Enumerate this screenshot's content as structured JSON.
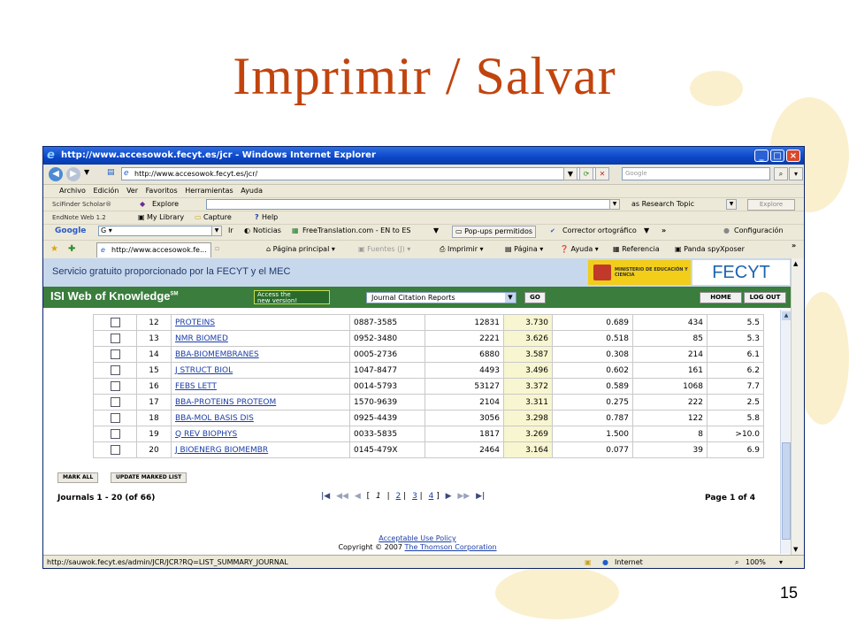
{
  "slide": {
    "title": "Imprimir / Salvar",
    "number": "15"
  },
  "window": {
    "title": "http://www.accesowok.fecyt.es/jcr - Windows Internet Explorer",
    "controls": [
      "_",
      "□",
      "×"
    ]
  },
  "address": {
    "url": "http://www.accesowok.fecyt.es/jcr/",
    "search_placeholder": "Google"
  },
  "menu": [
    "Archivo",
    "Edición",
    "Ver",
    "Favoritos",
    "Herramientas",
    "Ayuda"
  ],
  "toolbars": {
    "scifinder": {
      "label": "SciFinder Scholar®",
      "explore": "Explore",
      "topic": "as Research Topic",
      "explore_btn": "Explore"
    },
    "endnote": {
      "label": "EndNote Web 1.2",
      "my_library": "My Library",
      "capture": "Capture",
      "help": "Help"
    },
    "google": {
      "logo": "Google",
      "g_box": "G",
      "ir": "Ir",
      "noticias": "Noticias",
      "freetranslation": "FreeTranslation.com - EN to ES",
      "popups": "Pop-ups permitidos",
      "corrector": "Corrector ortográfico",
      "chevron": "»",
      "config": "Configuración"
    }
  },
  "tab": {
    "label": "http://www.accesowok.fe..."
  },
  "commands": {
    "home": "Página principal",
    "feeds": "Fuentes (J)",
    "print": "Imprimir",
    "page": "Página",
    "help": "Ayuda",
    "ref": "Referencia",
    "panda": "Panda spyXposer"
  },
  "page": {
    "banner": "Servicio gratuito proporcionado por la FECYT y el MEC",
    "ministerio": "MINISTERIO DE EDUCACIÓN Y CIENCIA",
    "fecyt_logo": "FECYT",
    "isi": {
      "title": "ISI Web of Knowledge",
      "sm": "SM",
      "access_line1": "Access the",
      "access_line2": "new version!",
      "product": "Journal Citation Reports",
      "go": "GO",
      "home": "HOME",
      "logout": "LOG OUT"
    },
    "rows": [
      {
        "rank": "12",
        "title": "PROTEINS",
        "issn": "0887-3585",
        "cites": "12831",
        "impact": "3.730",
        "immediacy": "0.689",
        "articles": "434",
        "halflife": "5.5"
      },
      {
        "rank": "13",
        "title": "NMR BIOMED",
        "issn": "0952-3480",
        "cites": "2221",
        "impact": "3.626",
        "immediacy": "0.518",
        "articles": "85",
        "halflife": "5.3"
      },
      {
        "rank": "14",
        "title": "BBA-BIOMEMBRANES",
        "issn": "0005-2736",
        "cites": "6880",
        "impact": "3.587",
        "immediacy": "0.308",
        "articles": "214",
        "halflife": "6.1"
      },
      {
        "rank": "15",
        "title": "J STRUCT BIOL",
        "issn": "1047-8477",
        "cites": "4493",
        "impact": "3.496",
        "immediacy": "0.602",
        "articles": "161",
        "halflife": "6.2"
      },
      {
        "rank": "16",
        "title": "FEBS LETT",
        "issn": "0014-5793",
        "cites": "53127",
        "impact": "3.372",
        "immediacy": "0.589",
        "articles": "1068",
        "halflife": "7.7"
      },
      {
        "rank": "17",
        "title": "BBA-PROTEINS PROTEOM",
        "issn": "1570-9639",
        "cites": "2104",
        "impact": "3.311",
        "immediacy": "0.275",
        "articles": "222",
        "halflife": "2.5"
      },
      {
        "rank": "18",
        "title": "BBA-MOL BASIS DIS",
        "issn": "0925-4439",
        "cites": "3056",
        "impact": "3.298",
        "immediacy": "0.787",
        "articles": "122",
        "halflife": "5.8"
      },
      {
        "rank": "19",
        "title": "Q REV BIOPHYS",
        "issn": "0033-5835",
        "cites": "1817",
        "impact": "3.269",
        "immediacy": "1.500",
        "articles": "8",
        "halflife": ">10.0"
      },
      {
        "rank": "20",
        "title": "J BIOENERG BIOMEMBR",
        "issn": "0145-479X",
        "cites": "2464",
        "impact": "3.164",
        "immediacy": "0.077",
        "articles": "39",
        "halflife": "6.9"
      }
    ],
    "mark_all": "MARK ALL",
    "update_marked": "UPDATE MARKED LIST",
    "journals_count": "Journals 1 - 20 (of 66)",
    "pager": {
      "open": "[",
      "p1": "1",
      "sep": "|",
      "p2": "2",
      "p3": "3",
      "p4": "4",
      "close": "]"
    },
    "page_of": "Page 1 of 4",
    "acceptable_use": "Acceptable Use Policy",
    "copyright_prefix": "Copyright © 2007",
    "thomson": "The Thomson Corporation"
  },
  "status": {
    "url": "http://sauwok.fecyt.es/admin/JCR/JCR?RQ=LIST_SUMMARY_JOURNAL",
    "zone": "Internet",
    "zoom": "100%"
  },
  "colors": {
    "slide_title": "#c1440e",
    "xp_title": "#0a46c8",
    "isi_green": "#3a7d3c",
    "impact_highlight": "#f8f6d0"
  }
}
